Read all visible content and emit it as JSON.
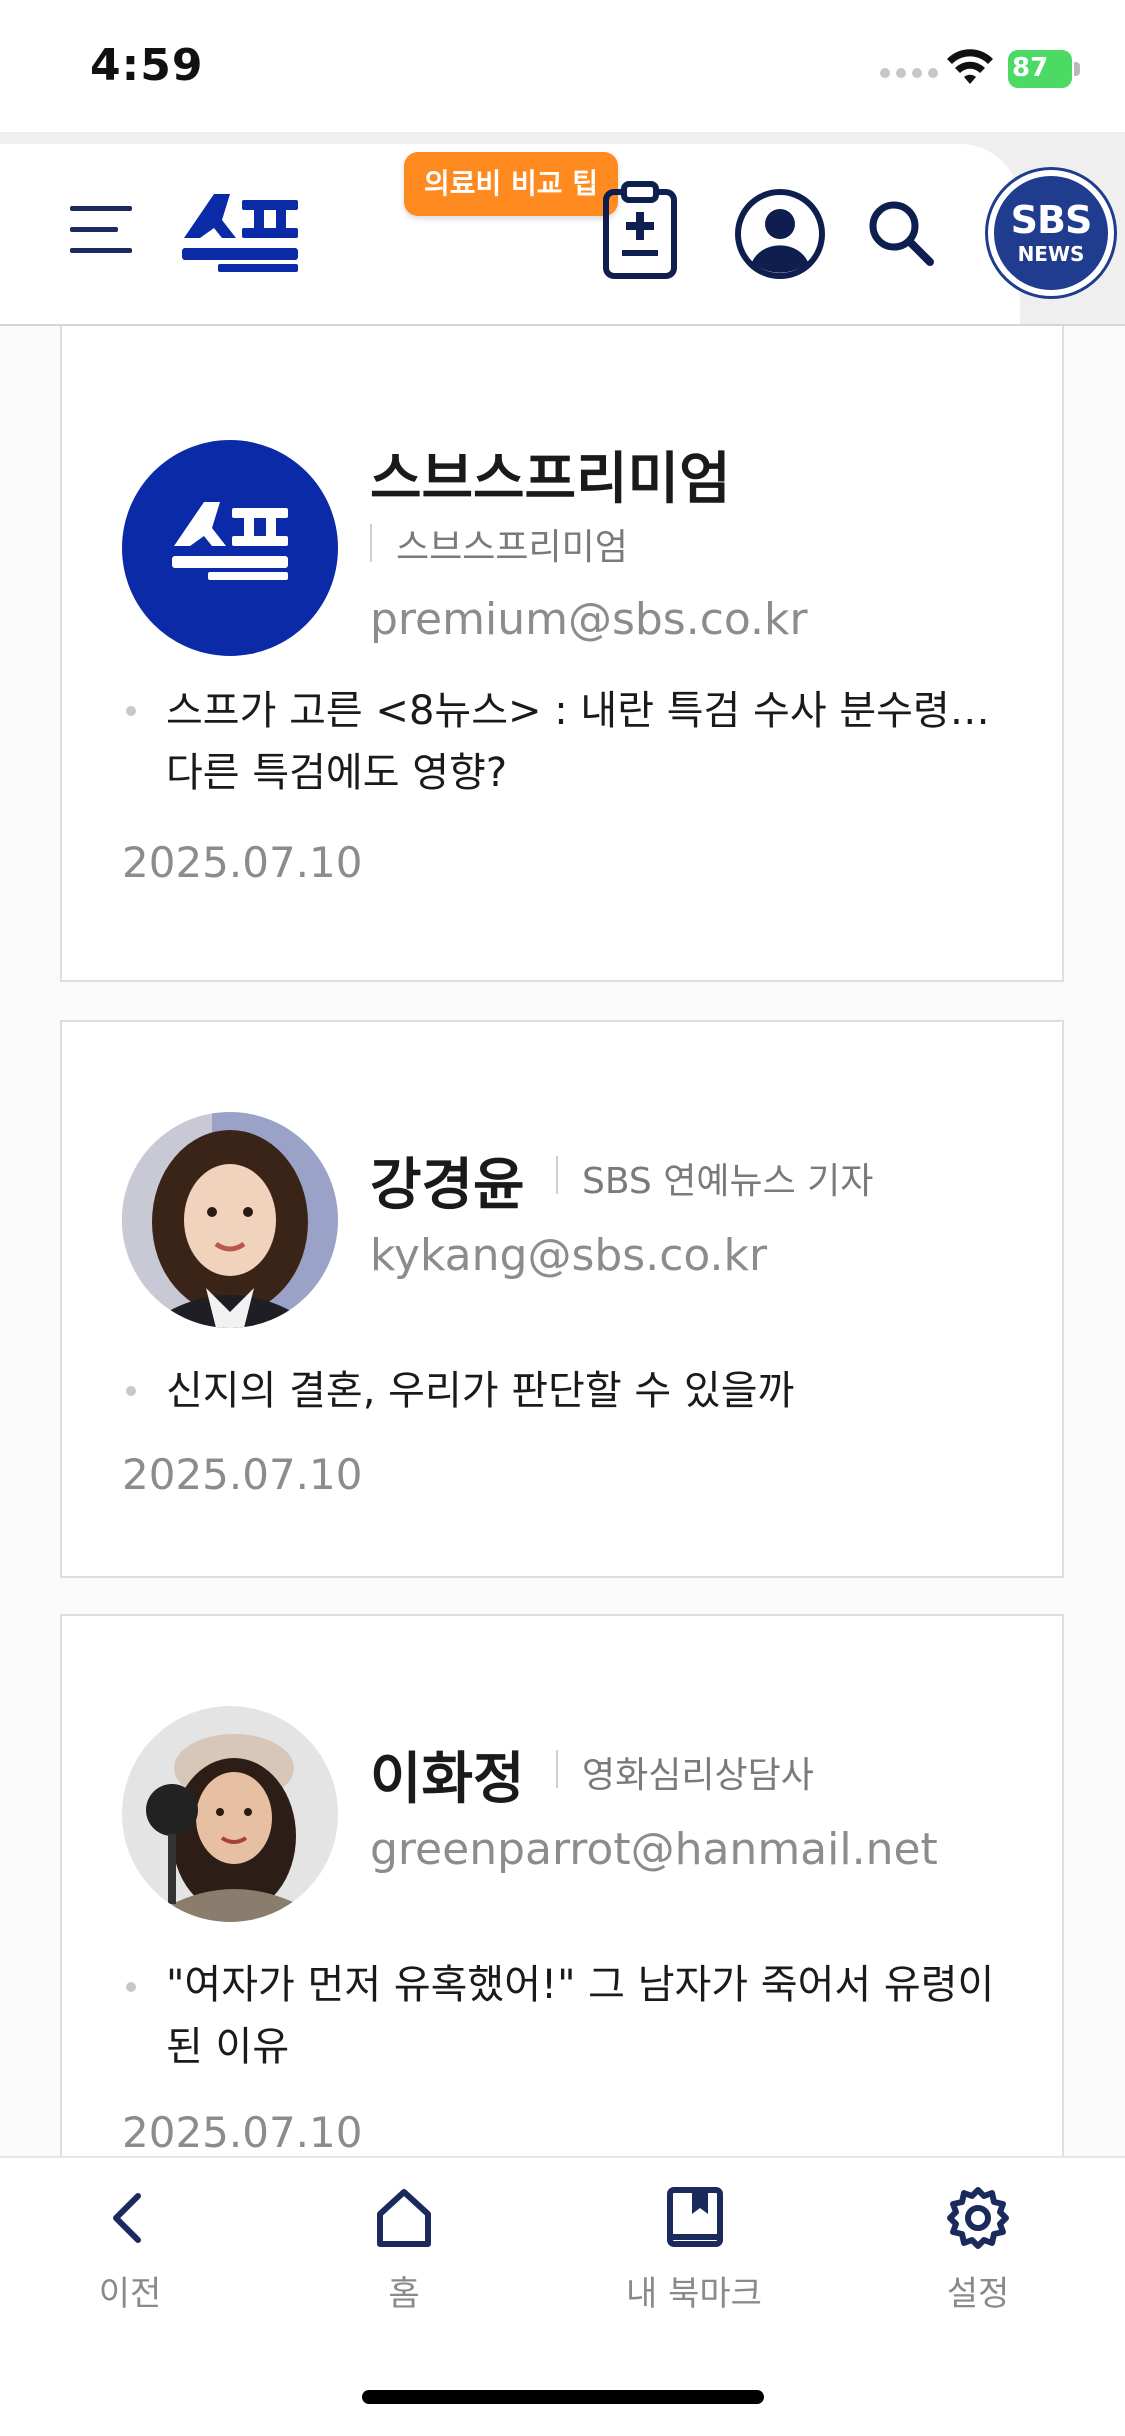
{
  "status_bar": {
    "time": "4:59",
    "battery": "87"
  },
  "header": {
    "promo_badge": "의료비 비교 팁",
    "sbs_logo_top": "SBS",
    "sbs_logo_bottom": "NEWS",
    "colors": {
      "brand_blue": "#0b2aa8",
      "promo_orange": "#ff8a1f",
      "sbs_navy": "#1f3c8e"
    }
  },
  "cards": [
    {
      "name": "스브스프리미엄",
      "role": "스브스프리미엄",
      "email": "premium@sbs.co.kr",
      "article": "스프가 고른 <8뉴스> : 내란 특검 수사 분수령… 다른 특검에도 영향?",
      "date": "2025.07.10",
      "avatar_icon": "supeu-logo-avatar"
    },
    {
      "name": "강경윤",
      "role": "SBS 연예뉴스 기자",
      "email": "kykang@sbs.co.kr",
      "article": "신지의 결혼, 우리가 판단할 수 있을까",
      "date": "2025.07.10",
      "avatar_icon": "reporter-photo"
    },
    {
      "name": "이화정",
      "role": "영화심리상담사",
      "email": "greenparrot@hanmail.net",
      "article": "\"여자가 먼저 유혹했어!\" 그 남자가 죽어서 유령이 된 이유",
      "date": "2025.07.10",
      "avatar_icon": "counselor-photo"
    }
  ],
  "tab_bar": [
    {
      "label": "이전",
      "icon": "chevron-left-icon"
    },
    {
      "label": "홈",
      "icon": "home-icon"
    },
    {
      "label": "내 북마크",
      "icon": "bookmark-book-icon"
    },
    {
      "label": "설정",
      "icon": "gear-icon"
    }
  ]
}
